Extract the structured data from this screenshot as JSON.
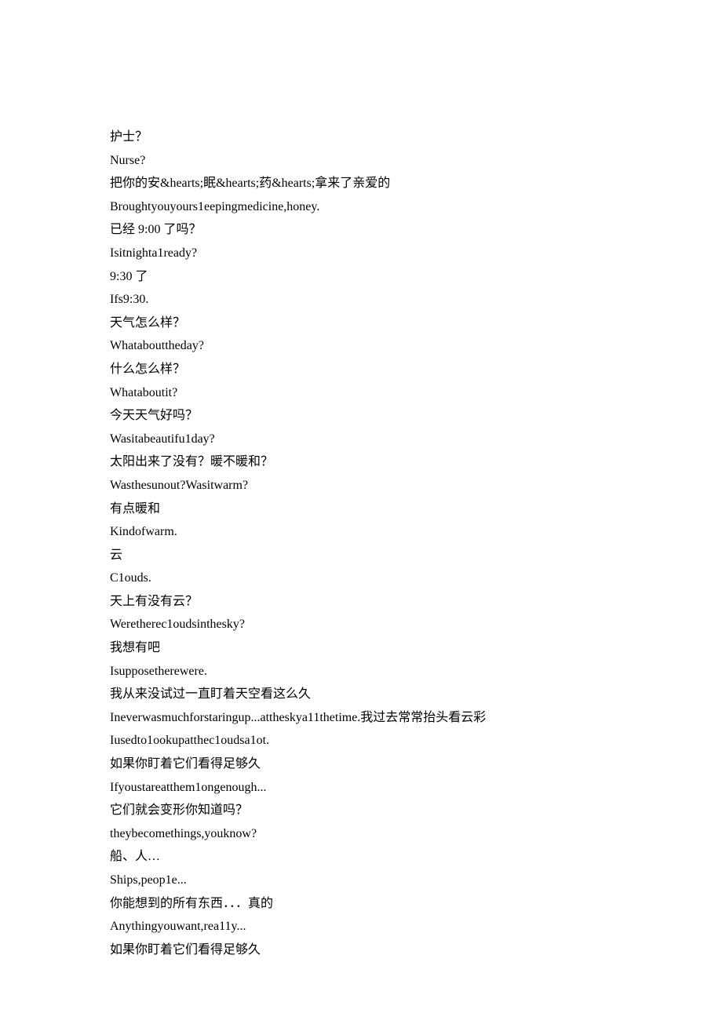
{
  "lines": [
    "护士？",
    "Nurse?",
    "把你的安&hearts;眠&hearts;药&hearts;拿来了亲爱的",
    "Broughtyouyours1eepingmedicine,honey.",
    "已经 9:00 了吗？",
    "Isitnighta1ready?",
    "9:30 了",
    "Ifs9:30.",
    "天气怎么样？",
    "Whatabouttheday?",
    "什么怎么样？",
    "Whataboutit?",
    "今天天气好吗？",
    "Wasitabeautifu1day?",
    "太阳出来了没有？暖不暖和？",
    "Wasthesunout?Wasitwarm?",
    "有点暖和",
    "Kindofwarm.",
    "云",
    "C1ouds.",
    "天上有没有云？",
    "Weretherec1oudsinthesky?",
    "我想有吧",
    "Isupposetherewere.",
    "我从来没试过一直盯着天空看这么久",
    "Ineverwasmuchforstaringup...attheskya11thetime.我过去常常抬头看云彩",
    "Iusedto1ookupatthec1oudsa1ot.",
    "如果你盯着它们看得足够久",
    "Ifyoustareatthem1ongenough...",
    "它们就会变形你知道吗？",
    "theybecomethings,youknow?",
    "船、人…",
    "Ships,peop1e...",
    "你能想到的所有东西．．．真的",
    "Anythingyouwant,rea11y...",
    "如果你盯着它们看得足够久"
  ]
}
